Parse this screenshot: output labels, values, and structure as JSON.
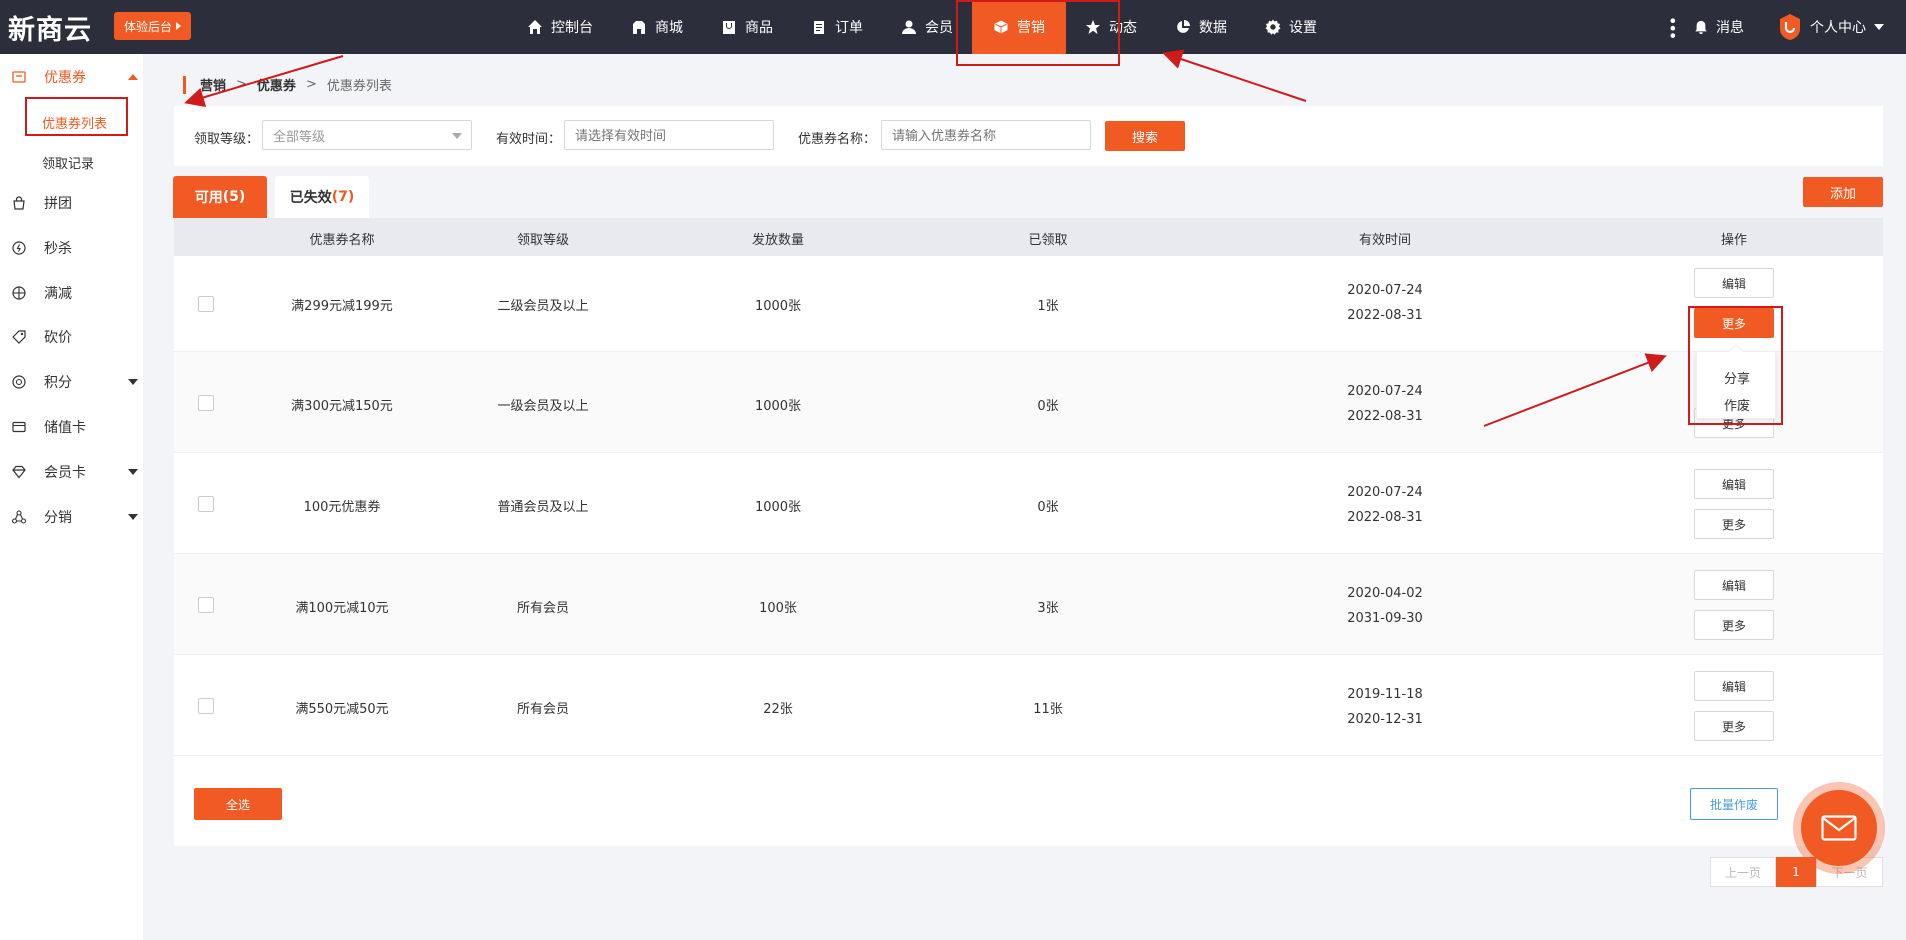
{
  "header": {
    "logo": "新商云",
    "trial_label": "体验后台",
    "nav": [
      {
        "label": "控制台",
        "icon": "home-icon"
      },
      {
        "label": "商城",
        "icon": "store-icon"
      },
      {
        "label": "商品",
        "icon": "bag-icon"
      },
      {
        "label": "订单",
        "icon": "order-icon"
      },
      {
        "label": "会员",
        "icon": "user-icon"
      },
      {
        "label": "营销",
        "icon": "cube-icon",
        "active": true
      },
      {
        "label": "动态",
        "icon": "star-icon"
      },
      {
        "label": "数据",
        "icon": "pie-icon"
      },
      {
        "label": "设置",
        "icon": "gear-icon"
      }
    ],
    "messages_label": "消息",
    "profile_label": "个人中心"
  },
  "sidebar": {
    "coupon": "优惠券",
    "coupon_list": "优惠券列表",
    "claim_records": "领取记录",
    "group": "拼团",
    "flash": "秒杀",
    "discount": "满减",
    "bargain": "砍价",
    "points": "积分",
    "stored_card": "储值卡",
    "member_card": "会员卡",
    "distribution": "分销"
  },
  "breadcrumb": {
    "level1": "营销",
    "sep": ">",
    "level2": "优惠券",
    "level3": "优惠券列表"
  },
  "filter": {
    "grade_label": "领取等级：",
    "grade_value": "全部等级",
    "time_label": "有效时间：",
    "time_placeholder": "请选择有效时间",
    "name_label": "优惠券名称：",
    "name_placeholder": "请输入优惠券名称",
    "search_label": "搜索"
  },
  "tabs": {
    "available_label": "可用",
    "available_count": "(5)",
    "expired_label": "已失效",
    "expired_count": "(7)"
  },
  "add_label": "添加",
  "table": {
    "headers": [
      "优惠券名称",
      "领取等级",
      "发放数量",
      "已领取",
      "有效时间",
      "操作"
    ],
    "rows": [
      {
        "name": "满299元减199元",
        "grade": "二级会员及以上",
        "qty": "1000张",
        "claimed": "1张",
        "start": "2020-07-24",
        "end": "2022-08-31"
      },
      {
        "name": "满300元减150元",
        "grade": "一级会员及以上",
        "qty": "1000张",
        "claimed": "0张",
        "start": "2020-07-24",
        "end": "2022-08-31"
      },
      {
        "name": "100元优惠券",
        "grade": "普通会员及以上",
        "qty": "1000张",
        "claimed": "0张",
        "start": "2020-07-24",
        "end": "2022-08-31"
      },
      {
        "name": "满100元减10元",
        "grade": "所有会员",
        "qty": "100张",
        "claimed": "3张",
        "start": "2020-04-02",
        "end": "2031-09-30"
      },
      {
        "name": "满550元减50元",
        "grade": "所有会员",
        "qty": "22张",
        "claimed": "11张",
        "start": "2019-11-18",
        "end": "2020-12-31"
      }
    ],
    "edit_label": "编辑",
    "more_label": "更多"
  },
  "dropdown": {
    "share": "分享",
    "void": "作废"
  },
  "footer": {
    "select_all": "全选",
    "batch_void": "批量作废"
  },
  "pager": {
    "prev": "上一页",
    "current": "1",
    "next": "下一页"
  },
  "colors": {
    "accent": "#f15a22",
    "topbar": "#2c2e3b",
    "annotation": "#d11a1a"
  }
}
